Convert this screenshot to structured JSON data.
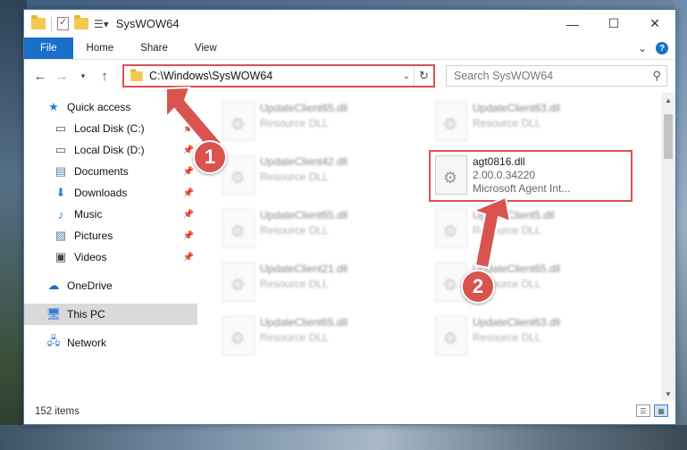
{
  "window": {
    "title": "SysWOW64"
  },
  "ribbon": {
    "tabs": [
      "File",
      "Home",
      "Share",
      "View"
    ]
  },
  "address": {
    "path": "C:\\Windows\\SysWOW64"
  },
  "search": {
    "placeholder": "Search SysWOW64"
  },
  "sidebar": {
    "items": [
      {
        "label": "Quick access",
        "icon": "star-icon",
        "pinned": false
      },
      {
        "label": "Local Disk (C:)",
        "icon": "drive-icon",
        "pinned": true
      },
      {
        "label": "Local Disk (D:)",
        "icon": "drive-icon",
        "pinned": true
      },
      {
        "label": "Documents",
        "icon": "documents-icon",
        "pinned": true
      },
      {
        "label": "Downloads",
        "icon": "download-icon",
        "pinned": true
      },
      {
        "label": "Music",
        "icon": "music-icon",
        "pinned": true
      },
      {
        "label": "Pictures",
        "icon": "pictures-icon",
        "pinned": true
      },
      {
        "label": "Videos",
        "icon": "videos-icon",
        "pinned": true
      },
      {
        "label": "OneDrive",
        "icon": "cloud-icon",
        "pinned": false
      },
      {
        "label": "This PC",
        "icon": "computer-icon",
        "pinned": false
      },
      {
        "label": "Network",
        "icon": "network-icon",
        "pinned": false
      }
    ]
  },
  "files": [
    {
      "name": "UpdateClient65.dll",
      "detail": "Resource DLL",
      "blurred": true
    },
    {
      "name": "UpdateClient63.dll",
      "detail": "Resource DLL",
      "blurred": true
    },
    {
      "name": "UpdateClient42.dll",
      "detail": "Resource DLL",
      "blurred": true
    },
    {
      "name": "agt0816.dll",
      "detail": "2.00.0.34220",
      "detail2": "Microsoft Agent Int...",
      "blurred": false
    },
    {
      "name": "UpdateClient65.dll",
      "detail": "Resource DLL",
      "blurred": true
    },
    {
      "name": "UpdateClient5.dll",
      "detail": "Resource DLL",
      "blurred": true
    },
    {
      "name": "UpdateClient21.dll",
      "detail": "Resource DLL",
      "blurred": true
    },
    {
      "name": "UpdateClient65.dll",
      "detail": "Resource DLL",
      "blurred": true
    },
    {
      "name": "UpdateClient65.dll",
      "detail": "Resource DLL",
      "blurred": true
    },
    {
      "name": "UpdateClient63.dll",
      "detail": "Resource DLL",
      "blurred": true
    }
  ],
  "status": {
    "item_count": "152 items"
  },
  "callouts": {
    "one": "1",
    "two": "2"
  },
  "colors": {
    "accent": "#1a6fc9",
    "callout": "#d9534f"
  }
}
